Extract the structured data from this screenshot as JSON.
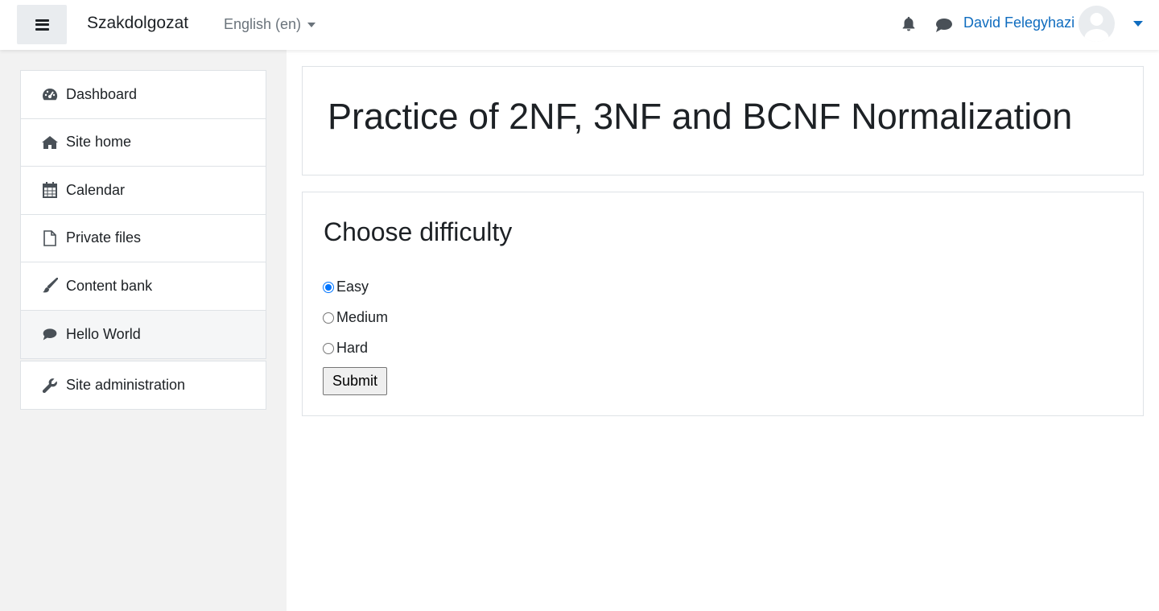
{
  "navbar": {
    "brand": "Szakdolgozat",
    "language": "English (en)",
    "user_name": "David Felegyhazi"
  },
  "sidebar": {
    "items": [
      {
        "label": "Dashboard",
        "icon": "dashboard-icon"
      },
      {
        "label": "Site home",
        "icon": "home-icon"
      },
      {
        "label": "Calendar",
        "icon": "calendar-icon"
      },
      {
        "label": "Private files",
        "icon": "file-icon"
      },
      {
        "label": "Content bank",
        "icon": "paintbrush-icon"
      },
      {
        "label": "Hello World",
        "icon": "chat-icon"
      }
    ],
    "admin": {
      "label": "Site administration",
      "icon": "wrench-icon"
    }
  },
  "main": {
    "page_title": "Practice of 2NF, 3NF and BCNF Normalization",
    "section_title": "Choose difficulty",
    "options": [
      "Easy",
      "Medium",
      "Hard"
    ],
    "selected": "Easy",
    "submit_label": "Submit"
  },
  "colors": {
    "link": "#0f6cbf",
    "sidebar_bg": "#f2f2f2",
    "radio_checked": "#0075ff"
  }
}
